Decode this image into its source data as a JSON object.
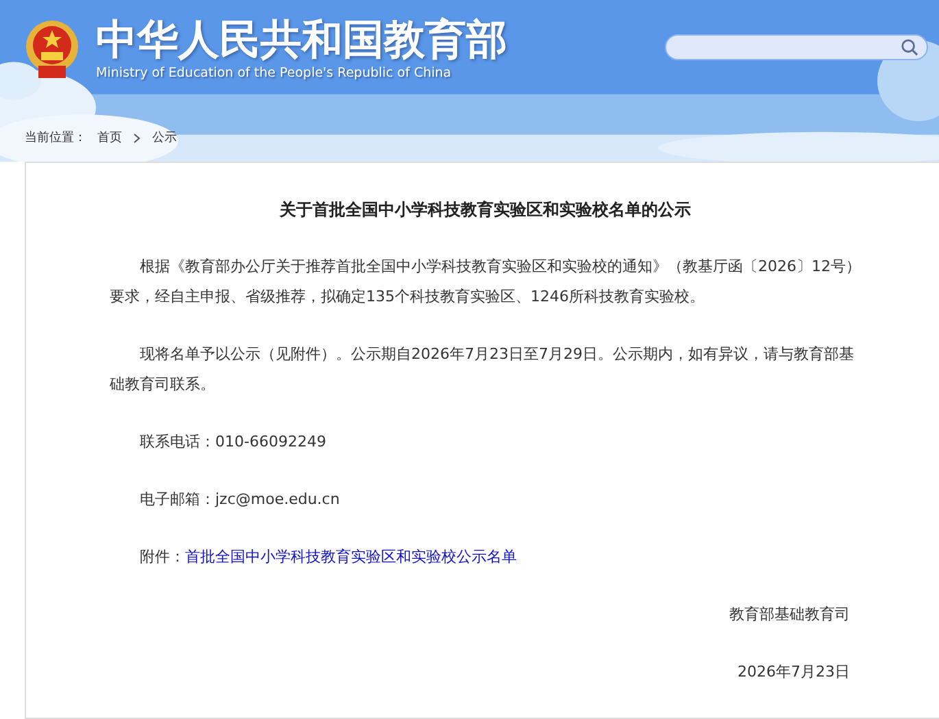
{
  "header": {
    "title": "中华人民共和国教育部",
    "subtitle": "Ministry of Education of the People's Republic of China"
  },
  "breadcrumb": {
    "label": "当前位置：",
    "items": [
      "首页",
      "公示"
    ]
  },
  "article": {
    "title": "关于首批全国中小学科技教育实验区和实验校名单的公示",
    "body": [
      {
        "kind": "paragraph",
        "text": "根据《教育部办公厅关于推荐首批全国中小学科技教育实验区和实验校的通知》（教基厅函〔2026〕12号）要求，经自主申报、省级推荐，拟确定135个科技教育实验区、1246所科技教育实验校。"
      },
      {
        "kind": "paragraph",
        "text": "现将名单予以公示（见附件）。公示期自2026年7月23日至7月29日。公示期内，如有异议，请与教育部基础教育司联系。"
      },
      {
        "kind": "paragraph",
        "text": "联系电话：010-66092249"
      },
      {
        "kind": "paragraph",
        "text": "电子邮箱：jzc@moe.edu.cn"
      },
      {
        "kind": "attachment",
        "label": "附件：",
        "link": "首批全国中小学科技教育实验区和实验校公示名单"
      }
    ],
    "signature": "教育部基础教育司",
    "date": "2026年7月23日"
  }
}
